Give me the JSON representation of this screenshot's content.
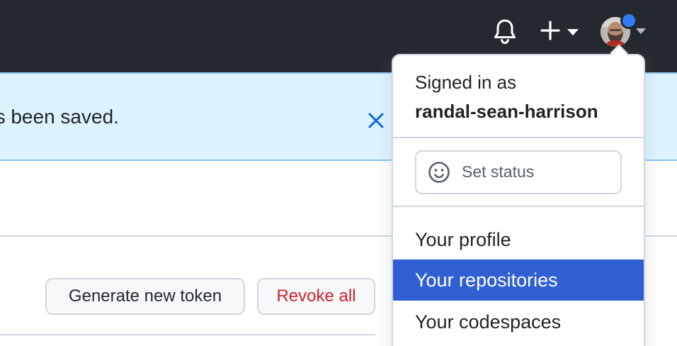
{
  "header": {
    "icons": {
      "notifications": "bell-icon",
      "create": "plus-icon",
      "create_menu": "caret-down-icon",
      "avatar_menu": "caret-down-icon"
    },
    "colors": {
      "background": "#24292f",
      "status_dot": "#2f7cf6"
    }
  },
  "flash": {
    "message": "as been saved.",
    "close_icon": "close-icon",
    "colors": {
      "background": "#ddf4ff",
      "border": "#8cc6f5",
      "icon": "#0969da"
    }
  },
  "actions": {
    "generate_label": "Generate new token",
    "revoke_label": "Revoke all",
    "colors": {
      "danger": "#cf222e"
    }
  },
  "user_menu": {
    "signed_in_label": "Signed in as",
    "username": "randal-sean-harrison",
    "set_status_label": "Set status",
    "status_icon": "smiley-icon",
    "items": [
      {
        "label": "Your profile",
        "selected": false
      },
      {
        "label": "Your repositories",
        "selected": true
      },
      {
        "label": "Your codespaces",
        "selected": false
      }
    ],
    "colors": {
      "selected_background": "#2f5fd0",
      "selected_text": "#ffffff"
    }
  }
}
